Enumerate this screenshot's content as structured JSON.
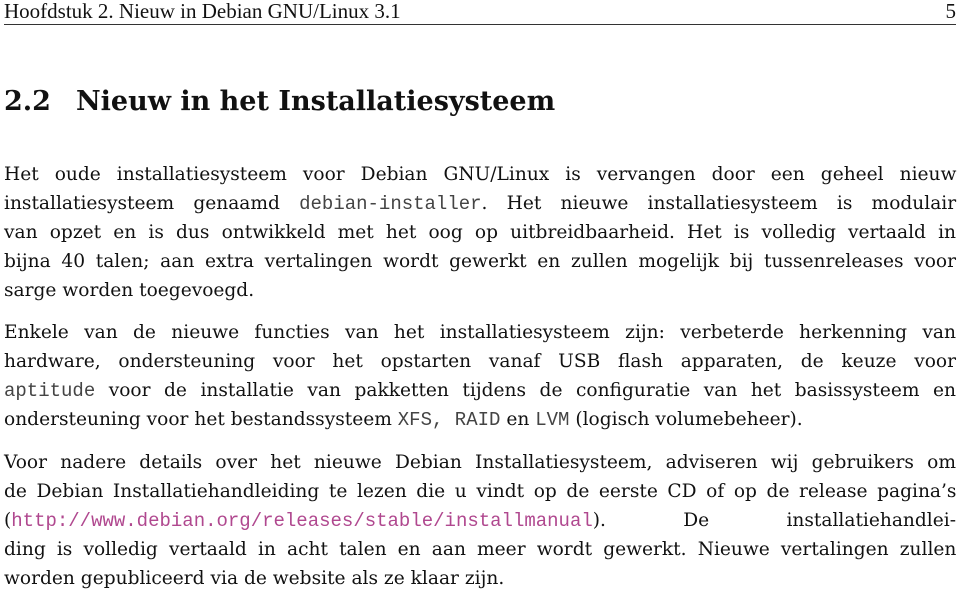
{
  "running_head": {
    "chapter": "Hoofdstuk 2. Nieuw in Debian GNU/Linux 3.1",
    "page_number": "5"
  },
  "section": {
    "number": "2.2",
    "title": "Nieuw in het Installatiesysteem"
  },
  "paragraph1": {
    "l1": "Het oude installatiesysteem voor Debian GNU/Linux is vervangen door een geheel nieuw",
    "l2a": "installatiesysteem genaamd ",
    "l2_code": "debian-installer",
    "l2b": ". Het nieuwe installatiesysteem is modulair",
    "l3": "van opzet en is dus ontwikkeld met het oog op uitbreidbaarheid.  Het is volledig vertaald in",
    "l4": "bijna 40 talen; aan extra vertalingen wordt gewerkt en zullen mogelijk bij tussenreleases voor",
    "l5": "sarge worden toegevoegd."
  },
  "paragraph2": {
    "l1": "Enkele van de nieuwe functies van het installatiesysteem zijn:  verbeterde herkenning van",
    "l2": "hardware, ondersteuning voor het opstarten vanaf USB flash apparaten, de keuze voor",
    "l3_code": "aptitude",
    "l3b": " voor de installatie van pakketten tijdens de configuratie van het basissysteem en",
    "l4a": "ondersteuning voor het bestandssysteem ",
    "l4_code1": "XFS",
    "l4_sep": ", ",
    "l4_code2": "RAID",
    "l4_mid": " en ",
    "l4_code3": "LVM",
    "l4b": " (logisch volumebeheer)."
  },
  "paragraph3": {
    "l1": "Voor nadere details over het nieuwe Debian Installatiesysteem, adviseren wij gebruikers om",
    "l2": "de Debian Installatiehandleiding te lezen die u vindt op de eerste CD of op de release pagina’s",
    "l3_open": "(",
    "l3_link": "http://www.debian.org/releases/stable/installmanual",
    "l3b": ").  De installatiehandlei-",
    "l4": "ding is volledig vertaald in acht talen en aan meer wordt gewerkt. Nieuwe vertalingen zullen",
    "l5": "worden gepubliceerd via de website als ze klaar zijn."
  },
  "colors": {
    "link": "#b0488f",
    "code": "#444444",
    "text": "#111111"
  }
}
